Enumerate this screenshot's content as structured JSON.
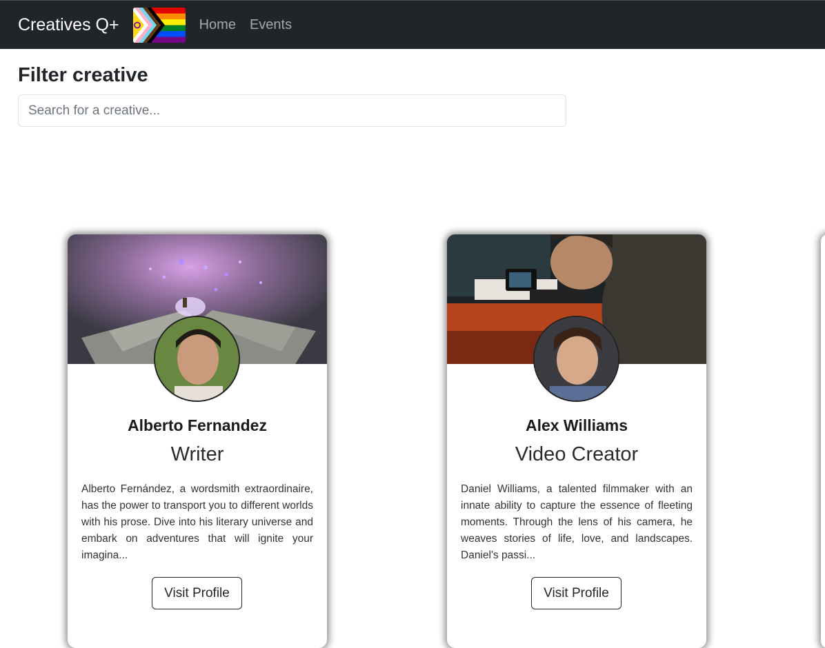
{
  "navbar": {
    "brand": "Creatives Q+",
    "links": [
      "Home",
      "Events"
    ]
  },
  "filter": {
    "title": "Filter creative",
    "placeholder": "Search for a creative..."
  },
  "cards": [
    {
      "name": "Alberto Fernandez",
      "role": "Writer",
      "description": "Alberto Fernández, a wordsmith extraordinaire, has the power to transport you to different worlds with his prose. Dive into his literary universe and embark on adventures that will ignite your imagina...",
      "button": "Visit Profile"
    },
    {
      "name": "Alex Williams",
      "role": "Video Creator",
      "description": "Daniel Williams, a talented filmmaker with an innate ability to capture the essence of fleeting moments. Through the lens of his camera, he weaves stories of life, love, and landscapes. Daniel's passi...",
      "button": "Visit Profile"
    }
  ],
  "colors": {
    "navbar_bg": "#212529",
    "card_shadow": "#000000"
  },
  "icons": {
    "flag": "progress-pride-flag-icon"
  }
}
